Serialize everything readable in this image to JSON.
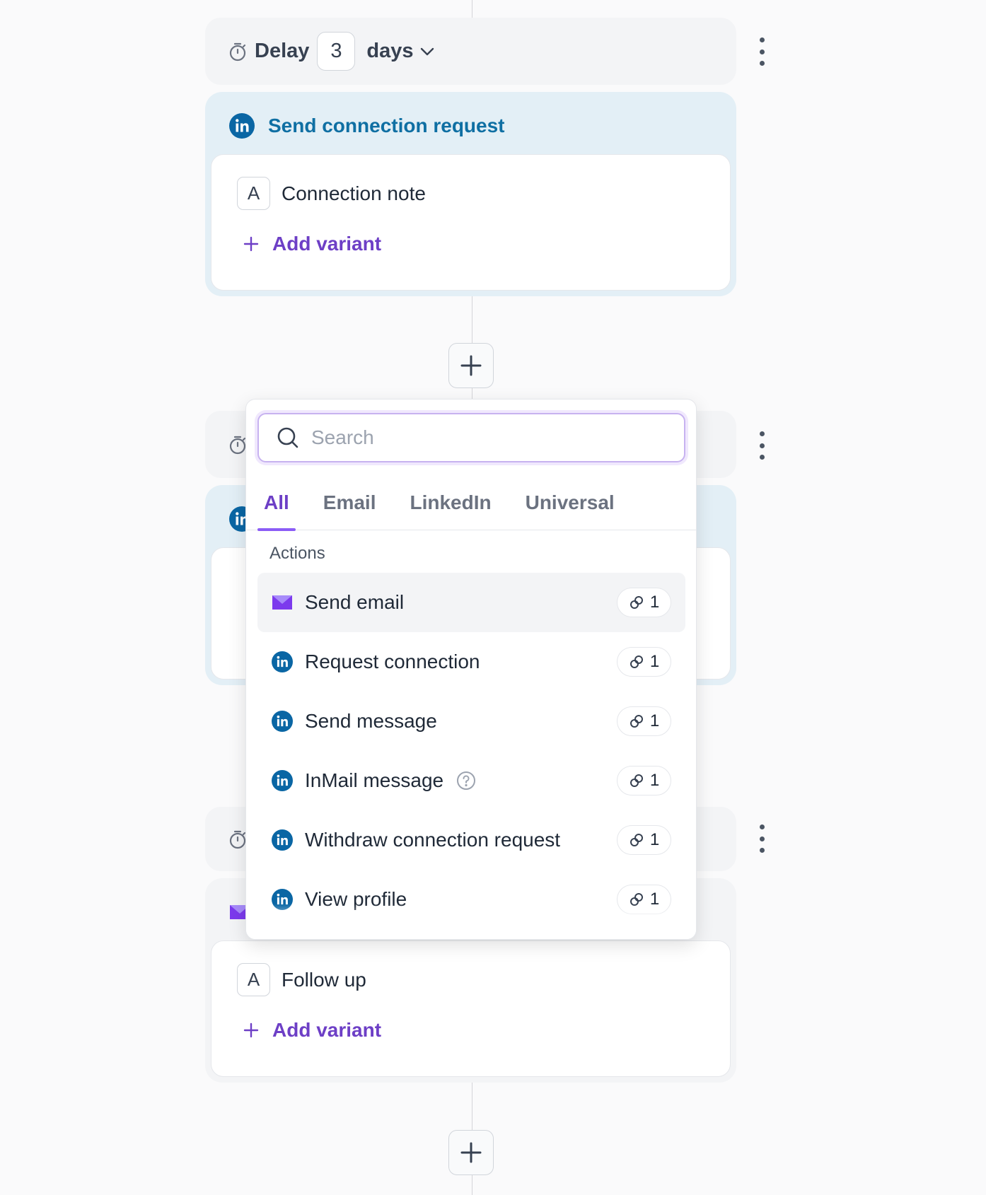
{
  "step1": {
    "delay_label": "Delay",
    "delay_value": "3",
    "delay_unit": "days",
    "action_title": "Send connection request",
    "variant_letter": "A",
    "variant_name": "Connection note",
    "add_variant": "Add variant"
  },
  "step3": {
    "variant_letter": "A",
    "variant_name": "Follow up",
    "add_variant": "Add variant"
  },
  "popup": {
    "search_placeholder": "Search",
    "tabs": [
      {
        "label": "All",
        "active": true
      },
      {
        "label": "Email",
        "active": false
      },
      {
        "label": "LinkedIn",
        "active": false
      },
      {
        "label": "Universal",
        "active": false
      }
    ],
    "section_label": "Actions",
    "actions": [
      {
        "label": "Send email",
        "icon": "email-icon",
        "count": "1"
      },
      {
        "label": "Request connection",
        "icon": "linkedin-icon",
        "count": "1"
      },
      {
        "label": "Send message",
        "icon": "linkedin-icon",
        "count": "1"
      },
      {
        "label": "InMail message",
        "icon": "linkedin-icon",
        "count": "1",
        "help": true
      },
      {
        "label": "Withdraw connection request",
        "icon": "linkedin-icon",
        "count": "1"
      },
      {
        "label": "View profile",
        "icon": "linkedin-icon",
        "count": "1"
      }
    ]
  },
  "colors": {
    "linkedin": "#0a66a4",
    "accent": "#6d3fc6",
    "email_icon": "#8b5cf6"
  }
}
